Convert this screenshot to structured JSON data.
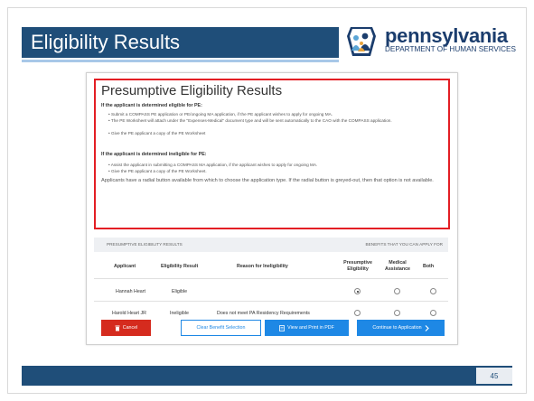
{
  "slide": {
    "title": "Eligibility Results",
    "page_number": "45",
    "colors": {
      "title_bar": "#1f4e79",
      "accent_red": "#e31e24",
      "button_blue": "#1e88e5",
      "cancel_red": "#d52b1e"
    }
  },
  "logo": {
    "name": "pennsylvania",
    "dept": "DEPARTMENT OF HUMAN SERVICES",
    "icon": "keystone-family-seal-icon"
  },
  "callout": {
    "title": "Presumptive Eligibility Results",
    "eligible_heading": "If the applicant is determined eligible for PE:",
    "eligible_bullets": [
      "Submit a COMPASS PE application or PE/ongoing MA application, if the PE applicant wishes to apply for ongoing MA.",
      "The PE Worksheet will attach under the \"Expenses-Medical\" document type and will be sent automatically to the CAO with the COMPASS application.",
      "Give the PE applicant a copy of the PE Worksheet"
    ],
    "ineligible_heading": "If the applicant is determined ineligible for PE:",
    "ineligible_bullets": [
      "Assist the applicant in submitting a COMPASS MA application, if the applicant wishes to apply for ongoing MA.",
      "Give the PE applicant a copy of the PE Worksheet."
    ],
    "note": "Applicants have a radial button available from which to choose the application type. If the radial button is greyed-out, then that option is not available."
  },
  "results_table": {
    "section_left": "PRESUMPTIVE ELIGIBILITY RESULTS",
    "section_right": "BENEFITS THAT YOU CAN APPLY FOR",
    "columns": {
      "applicant": "Applicant",
      "result": "Eligibility Result",
      "reason": "Reason for Ineligibility",
      "pe": "Presumptive Eligibility",
      "ma": "Medical Assistance",
      "both": "Both"
    },
    "rows": [
      {
        "applicant": "Hannah Heart",
        "result": "Eligible",
        "reason": "",
        "selected": "pe"
      },
      {
        "applicant": "Harold Heart JR",
        "result": "Ineligible",
        "reason": "Does not meet PA Residency Requirements",
        "selected": ""
      }
    ]
  },
  "buttons": {
    "cancel": "Cancel",
    "clear": "Clear Benefit Selection",
    "pdf": "View and Print in PDF",
    "continue": "Continue to Application"
  }
}
